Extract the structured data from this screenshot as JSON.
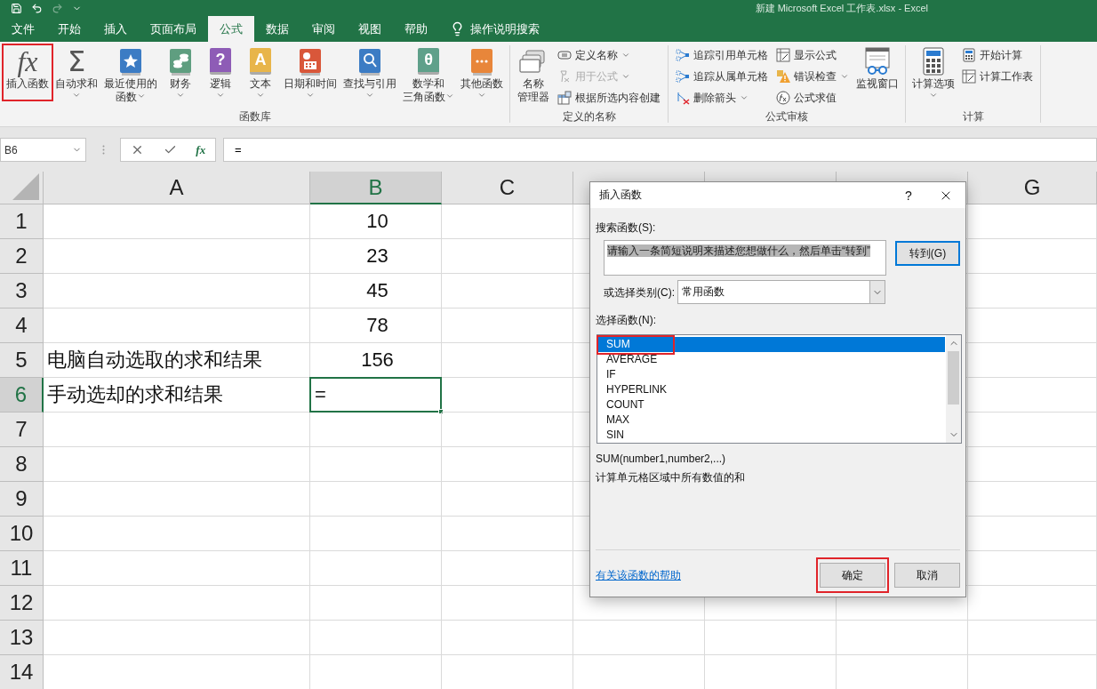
{
  "title_bar": {
    "title": "新建 Microsoft Excel 工作表.xlsx  -  Excel"
  },
  "tabs": [
    {
      "label": "文件",
      "selected": false
    },
    {
      "label": "开始",
      "selected": false
    },
    {
      "label": "插入",
      "selected": false
    },
    {
      "label": "页面布局",
      "selected": false
    },
    {
      "label": "公式",
      "selected": true
    },
    {
      "label": "数据",
      "selected": false
    },
    {
      "label": "审阅",
      "selected": false
    },
    {
      "label": "视图",
      "selected": false
    },
    {
      "label": "帮助",
      "selected": false
    }
  ],
  "tell_me": {
    "label": "操作说明搜索"
  },
  "ribbon_groups": [
    {
      "label": "函数库",
      "items": [
        {
          "kind": "fx",
          "glyph": "fx",
          "lines": [
            "插入函数"
          ],
          "dropdown": false,
          "highlighted": true
        },
        {
          "kind": "sigma",
          "glyph": "Σ",
          "lines": [
            "自动求和"
          ],
          "dropdown": true,
          "highlighted": false
        },
        {
          "kind": "star",
          "color": "#3c7cc4",
          "lines": [
            "最近使用的",
            "函数"
          ],
          "dropdown": true,
          "highlighted": false
        },
        {
          "kind": "coins",
          "color": "#5f9e80",
          "lines": [
            "财务"
          ],
          "dropdown": true,
          "highlighted": false
        },
        {
          "kind": "glyphbook",
          "glyph": "?",
          "color": "#8e5cb6",
          "lines": [
            "逻辑"
          ],
          "dropdown": true,
          "highlighted": false
        },
        {
          "kind": "glyphbook",
          "glyph": "A",
          "color": "#e8b54a",
          "lines": [
            "文本"
          ],
          "dropdown": true,
          "highlighted": false
        },
        {
          "kind": "calendar",
          "color": "#d9573a",
          "lines": [
            "日期和时间"
          ],
          "dropdown": true,
          "highlighted": false
        },
        {
          "kind": "search",
          "color": "#3c7cc4",
          "lines": [
            "查找与引用"
          ],
          "dropdown": true,
          "highlighted": false
        },
        {
          "kind": "glyphbook",
          "glyph": "θ",
          "color": "#5fa08a",
          "lines": [
            "数学和",
            "三角函数"
          ],
          "dropdown": true,
          "highlighted": false
        },
        {
          "kind": "dots",
          "color": "#e8863a",
          "lines": [
            "其他函数"
          ],
          "dropdown": true,
          "highlighted": false
        }
      ]
    },
    {
      "label": "定义的名称",
      "items": [
        {
          "kind": "names",
          "lines": [
            "名称",
            "管理器"
          ],
          "dropdown": false,
          "highlighted": false
        },
        {
          "kind": "stack",
          "items": [
            {
              "kind": "tag",
              "label": "定义名称",
              "dropdown": true,
              "disabled": false
            },
            {
              "kind": "fxghost",
              "label": "用于公式",
              "dropdown": true,
              "disabled": true
            },
            {
              "kind": "table",
              "label": "根据所选内容创建",
              "dropdown": false,
              "disabled": false
            }
          ]
        }
      ]
    },
    {
      "label": "公式审核",
      "items": [
        {
          "kind": "stack",
          "items": [
            {
              "kind": "trace",
              "label": "追踪引用单元格",
              "dropdown": false,
              "disabled": false
            },
            {
              "kind": "trace",
              "label": "追踪从属单元格",
              "dropdown": false,
              "disabled": false
            },
            {
              "kind": "unarrow",
              "label": "删除箭头",
              "dropdown": true,
              "disabled": false
            }
          ]
        },
        {
          "kind": "stack",
          "items": [
            {
              "kind": "sheet",
              "label": "显示公式",
              "dropdown": false,
              "disabled": false
            },
            {
              "kind": "warning",
              "label": "错误检查",
              "dropdown": true,
              "disabled": false
            },
            {
              "kind": "fxcircle",
              "label": "公式求值",
              "dropdown": false,
              "disabled": false
            }
          ]
        },
        {
          "kind": "watch",
          "lines": [
            "监视窗口"
          ],
          "dropdown": false,
          "highlighted": false
        }
      ]
    },
    {
      "label": "计算",
      "items": [
        {
          "kind": "calculator",
          "lines": [
            "计算选项"
          ],
          "dropdown": true,
          "highlighted": false
        },
        {
          "kind": "stack",
          "items": [
            {
              "kind": "calculator",
              "label": "开始计算",
              "dropdown": false,
              "disabled": false
            },
            {
              "kind": "sheet",
              "label": "计算工作表",
              "dropdown": false,
              "disabled": false
            }
          ]
        }
      ]
    }
  ],
  "formula_bar": {
    "name_box": "B6",
    "fx": "fx",
    "formula": "="
  },
  "sheet": {
    "columns": [
      {
        "label": "A",
        "selected": false
      },
      {
        "label": "B",
        "selected": true
      },
      {
        "label": "C",
        "selected": false
      },
      {
        "selected": false
      },
      {
        "selected": false
      },
      {
        "selected": false
      },
      {
        "label": "G",
        "selected": false
      }
    ],
    "rows": [
      {
        "header": "1",
        "selected": false,
        "cells": [
          {
            "kind": "empty"
          },
          {
            "kind": "number",
            "text": "10",
            "active": false
          }
        ]
      },
      {
        "header": "2",
        "selected": false,
        "cells": [
          {
            "kind": "empty"
          },
          {
            "kind": "number",
            "text": "23",
            "active": false
          }
        ]
      },
      {
        "header": "3",
        "selected": false,
        "cells": [
          {
            "kind": "empty"
          },
          {
            "kind": "number",
            "text": "45",
            "active": false
          }
        ]
      },
      {
        "header": "4",
        "selected": false,
        "cells": [
          {
            "kind": "empty"
          },
          {
            "kind": "number",
            "text": "78",
            "active": false
          }
        ]
      },
      {
        "header": "5",
        "selected": false,
        "cells": [
          {
            "kind": "text",
            "text": "电脑自动选取的求和结果",
            "active": false
          },
          {
            "kind": "number",
            "text": "156",
            "active": false
          }
        ]
      },
      {
        "header": "6",
        "selected": true,
        "cells": [
          {
            "kind": "text",
            "text": "手动选却的求和结果",
            "active": false
          },
          {
            "kind": "formula",
            "text": "=",
            "active": true
          }
        ]
      },
      {
        "header": "7",
        "selected": false
      },
      {
        "header": "8",
        "selected": false
      },
      {
        "header": "9",
        "selected": false
      },
      {
        "header": "10",
        "selected": false
      },
      {
        "header": "11",
        "selected": false
      },
      {
        "header": "12",
        "selected": false
      },
      {
        "header": "13",
        "selected": false
      },
      {
        "header": "14",
        "selected": false
      }
    ]
  },
  "dialog": {
    "title": "插入函数",
    "help": "?",
    "search_label": "搜索函数(S):",
    "search_value": "请输入一条简短说明来描述您想做什么，然后单击“转到”",
    "go_button": "转到(G)",
    "category_label": "或选择类别(C):",
    "category": "常用函数",
    "list_label": "选择函数(N):",
    "functions": [
      {
        "name": "SUM",
        "selected": true,
        "highlighted": true
      },
      {
        "name": "AVERAGE",
        "selected": false,
        "highlighted": false
      },
      {
        "name": "IF",
        "selected": false,
        "highlighted": false
      },
      {
        "name": "HYPERLINK",
        "selected": false,
        "highlighted": false
      },
      {
        "name": "COUNT",
        "selected": false,
        "highlighted": false
      },
      {
        "name": "MAX",
        "selected": false,
        "highlighted": false
      },
      {
        "name": "SIN",
        "selected": false,
        "highlighted": false
      }
    ],
    "signature": "SUM(number1,number2,...)",
    "description": "计算单元格区域中所有数值的和",
    "help_link": "有关该函数的帮助",
    "buttons": [
      {
        "label": "确定",
        "highlighted": true
      },
      {
        "label": "取消",
        "highlighted": false
      }
    ]
  }
}
